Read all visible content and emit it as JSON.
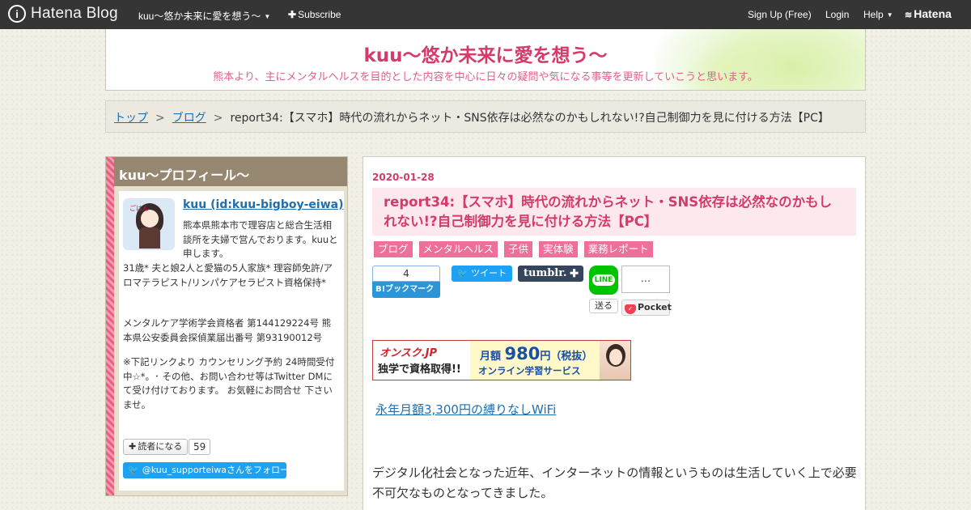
{
  "topbar": {
    "logo_text": "Hatena Blog",
    "blog_menu": "kuu～悠か未来に愛を想う～",
    "subscribe": "Subscribe",
    "signup": "Sign Up (Free)",
    "login": "Login",
    "help": "Help",
    "hatena": "Hatena"
  },
  "header": {
    "title": "kuu～悠か未来に愛を想う～",
    "description": "熊本より、主にメンタルヘルスを目的とした内容を中心に日々の疑問や気になる事等を更新していこうと思います。"
  },
  "breadcrumb": {
    "items": [
      "トップ",
      "ブログ"
    ],
    "separator": ">",
    "current": "report34:【スマホ】時代の流れからネット・SNS依存は必然なのかもしれない!?自己制御力を見に付ける方法【PC】"
  },
  "profile": {
    "section_title": "kuu～プロフィール～",
    "name": "kuu (id:kuu-bigboy-eiwa)",
    "bio1": "熊本県熊本市で理容店と総合生活相談所を夫婦で営んでおります。kuuと申します。",
    "bio2": "31歳* 夫と娘2人と愛猫の5人家族* 理容師免許/アロマテラピスト/リンパケアセラピスト資格保持*",
    "bio3": "メンタルケア学術学会資格者 第144129224号 熊本県公安委員会探偵業届出番号 第93190012号",
    "bio4": "※下記リンクより カウンセリング予約 24時間受付中☆*。･ その他、お問い合わせ等はTwitter DMにて受け付けております。 お気軽にお問合せ 下さいませ。",
    "reader_button": "読者になる",
    "reader_count": "59",
    "follow_button": "@kuu_supporteiwaさんをフォロー",
    "avatar_text": "ごはん"
  },
  "article": {
    "date": "2020-01-28",
    "title": "report34:【スマホ】時代の流れからネット・SNS依存は必然なのかもしれない!?自己制御力を見に付ける方法【PC】",
    "categories": [
      "ブログ",
      "メンタルヘルス",
      "子供",
      "実体験",
      "業務レポート"
    ],
    "share": {
      "hatebu_count": "4",
      "hatebu_label": "B!ブックマーク",
      "tweet": "ツイート",
      "tumblr": "tumblr.",
      "line": "LINE",
      "line_send": "送る",
      "pocket_count": "...",
      "pocket": "Pocket"
    },
    "banner": {
      "brand": "オンスク.JP",
      "tagline": "独学で資格取得!!",
      "plan_prefix": "月額",
      "price": "980",
      "price_suffix": "円（税抜）",
      "service": "オンライン学習サービス"
    },
    "wifi_link": "永年月額3,300円の縛りなしWiFi",
    "body": "デジタル化社会となった近年、インターネットの情報というものは生活していく上で必要不可欠なものとなってきました。"
  },
  "colors": {
    "accent_pink": "#d53a6a",
    "category_pink": "#ee6f99",
    "topbar": "#353535",
    "link_blue": "#1f6fb0",
    "profile_header": "#958770"
  }
}
